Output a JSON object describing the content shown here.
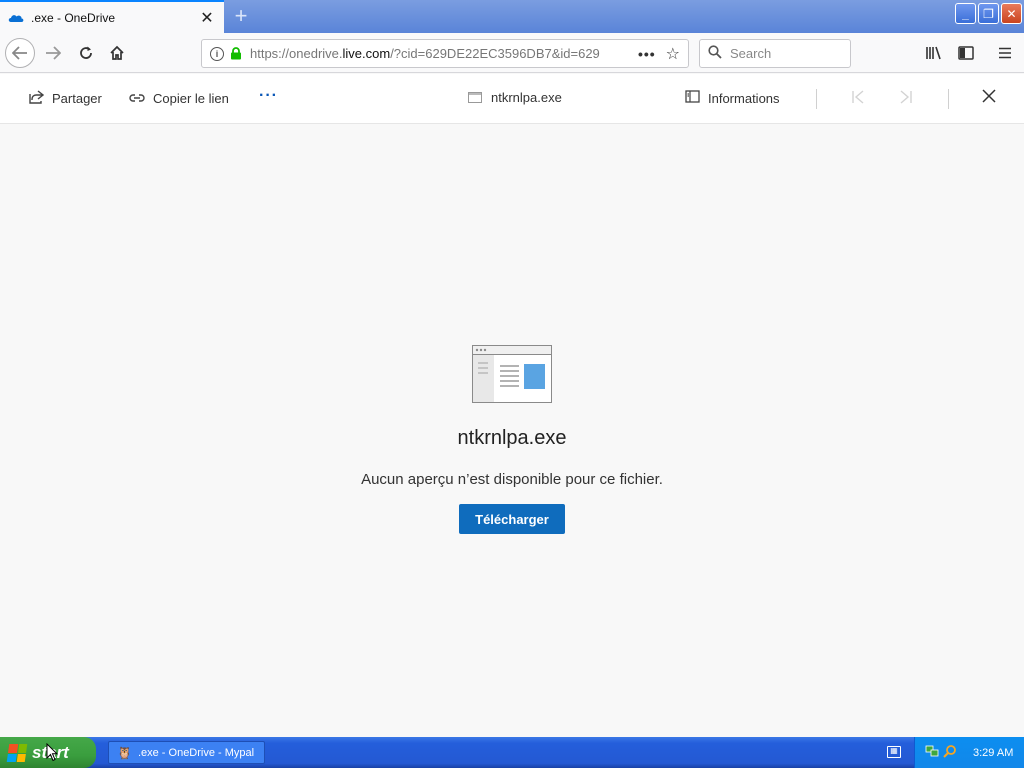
{
  "browser": {
    "tab_title": ".exe - OneDrive",
    "tab_close": "✕",
    "new_tab": "+",
    "url_prefix": "https://onedrive.",
    "url_domain": "live.com",
    "url_rest": "/?cid=629DE22EC3596DB7&id=629",
    "search_placeholder": "Search",
    "window_controls": {
      "minimize": "_",
      "restore": "❐",
      "close": "✕"
    }
  },
  "commandbar": {
    "share_label": "Partager",
    "copy_link_label": "Copier le lien",
    "more_label": "···",
    "file_name": "ntkrnlpa.exe",
    "info_label": "Informations"
  },
  "content": {
    "file_title": "ntkrnlpa.exe",
    "message": "Aucun aperçu n’est disponible pour ce fichier.",
    "download_label": "Télécharger"
  },
  "taskbar": {
    "start_label": "start",
    "task_item": ".exe - OneDrive - Mypal",
    "time": "3:29 AM"
  },
  "colors": {
    "accent": "#0f6cbd",
    "xp_taskbar": "#245edb",
    "start_green": "#3a9e3e"
  },
  "icons": [
    "onedrive-cloud-icon",
    "back-arrow-icon",
    "forward-arrow-icon",
    "reload-icon",
    "home-icon",
    "info-icon",
    "lock-icon",
    "page-actions-icon",
    "bookmark-star-icon",
    "search-icon",
    "library-icon",
    "sidebar-icon",
    "menu-icon",
    "share-icon",
    "link-icon",
    "file-icon",
    "info-panel-icon",
    "previous-icon",
    "next-icon",
    "close-icon",
    "windows-flag-icon",
    "keyboard-icon",
    "network-icon"
  ]
}
